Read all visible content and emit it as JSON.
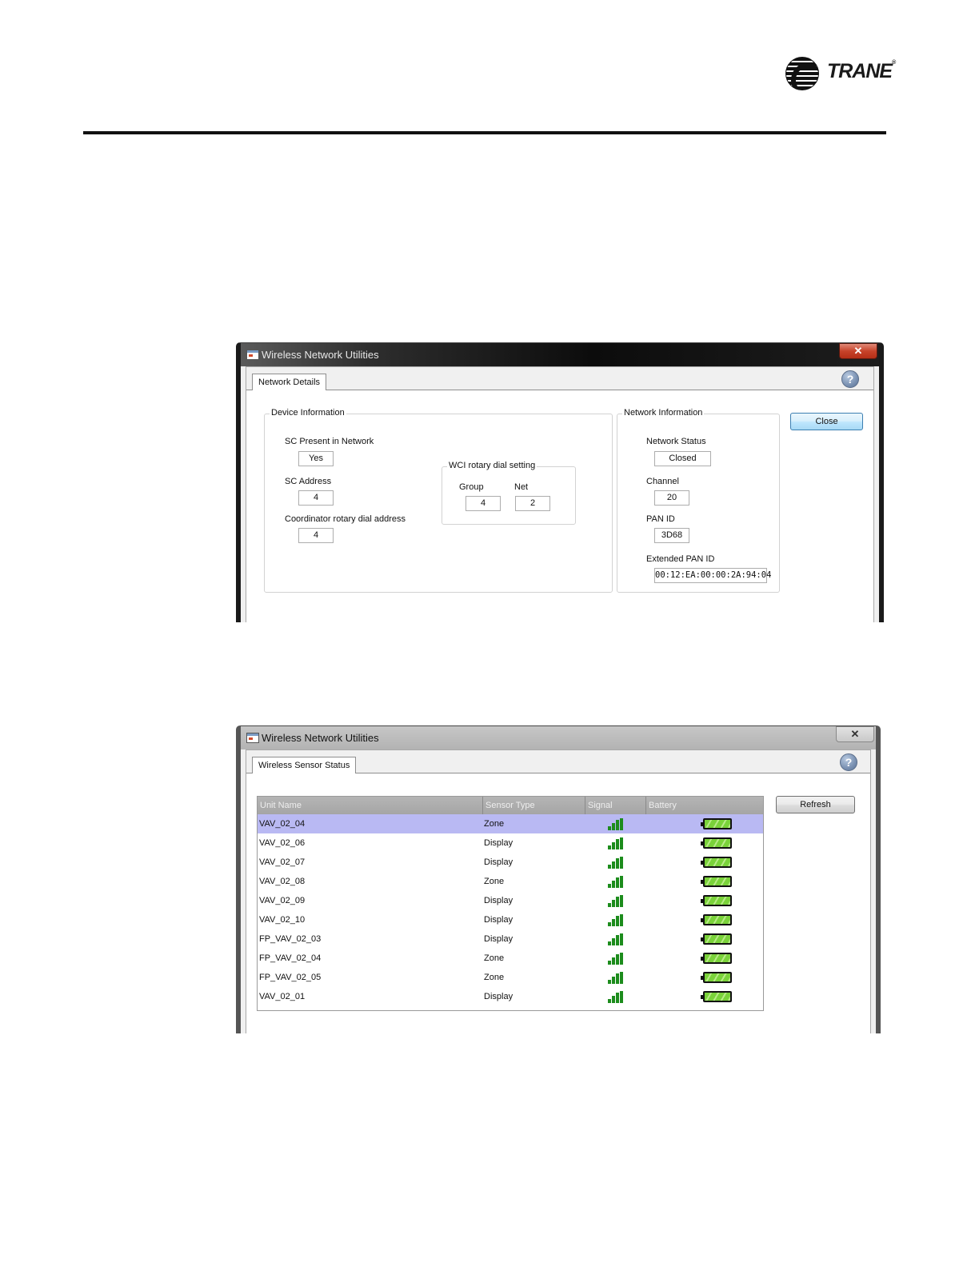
{
  "header": {
    "brand": "TRANE",
    "registered": "®"
  },
  "window1": {
    "title": "Wireless Network Utilities",
    "tab": "Network Details",
    "device_info": {
      "legend": "Device Information",
      "sc_present_label": "SC Present in Network",
      "sc_present_value": "Yes",
      "sc_address_label": "SC Address",
      "sc_address_value": "4",
      "coord_label": "Coordinator rotary dial address",
      "coord_value": "4"
    },
    "wci": {
      "legend": "WCI rotary dial setting",
      "group_label": "Group",
      "group_value": "4",
      "net_label": "Net",
      "net_value": "2"
    },
    "network_info": {
      "legend": "Network Information",
      "status_label": "Network Status",
      "status_value": "Closed",
      "channel_label": "Channel",
      "channel_value": "20",
      "pan_label": "PAN ID",
      "pan_value": "3D68",
      "ext_pan_label": "Extended PAN ID",
      "ext_pan_value": "00:12:EA:00:00:2A:94:04"
    },
    "close_label": "Close"
  },
  "window2": {
    "title": "Wireless Network Utilities",
    "tab": "Wireless Sensor Status",
    "refresh_label": "Refresh",
    "columns": [
      "Unit Name",
      "Sensor Type",
      "Signal",
      "Battery"
    ],
    "rows": [
      {
        "unit": "VAV_02_04",
        "type": "Zone"
      },
      {
        "unit": "VAV_02_06",
        "type": "Display"
      },
      {
        "unit": "VAV_02_07",
        "type": "Display"
      },
      {
        "unit": "VAV_02_08",
        "type": "Zone"
      },
      {
        "unit": "VAV_02_09",
        "type": "Display"
      },
      {
        "unit": "VAV_02_10",
        "type": "Display"
      },
      {
        "unit": "FP_VAV_02_03",
        "type": "Display"
      },
      {
        "unit": "FP_VAV_02_04",
        "type": "Zone"
      },
      {
        "unit": "FP_VAV_02_05",
        "type": "Zone"
      },
      {
        "unit": "VAV_02_01",
        "type": "Display"
      }
    ],
    "selected_row": 0
  },
  "icons": {
    "close": "close-icon",
    "help": "help-icon",
    "signal": "signal-strength-icon",
    "battery": "battery-full-icon"
  },
  "colors": {
    "selected_row": "#b9b9f3",
    "signal": "#1c8c1c",
    "battery": "#7ad23a"
  }
}
